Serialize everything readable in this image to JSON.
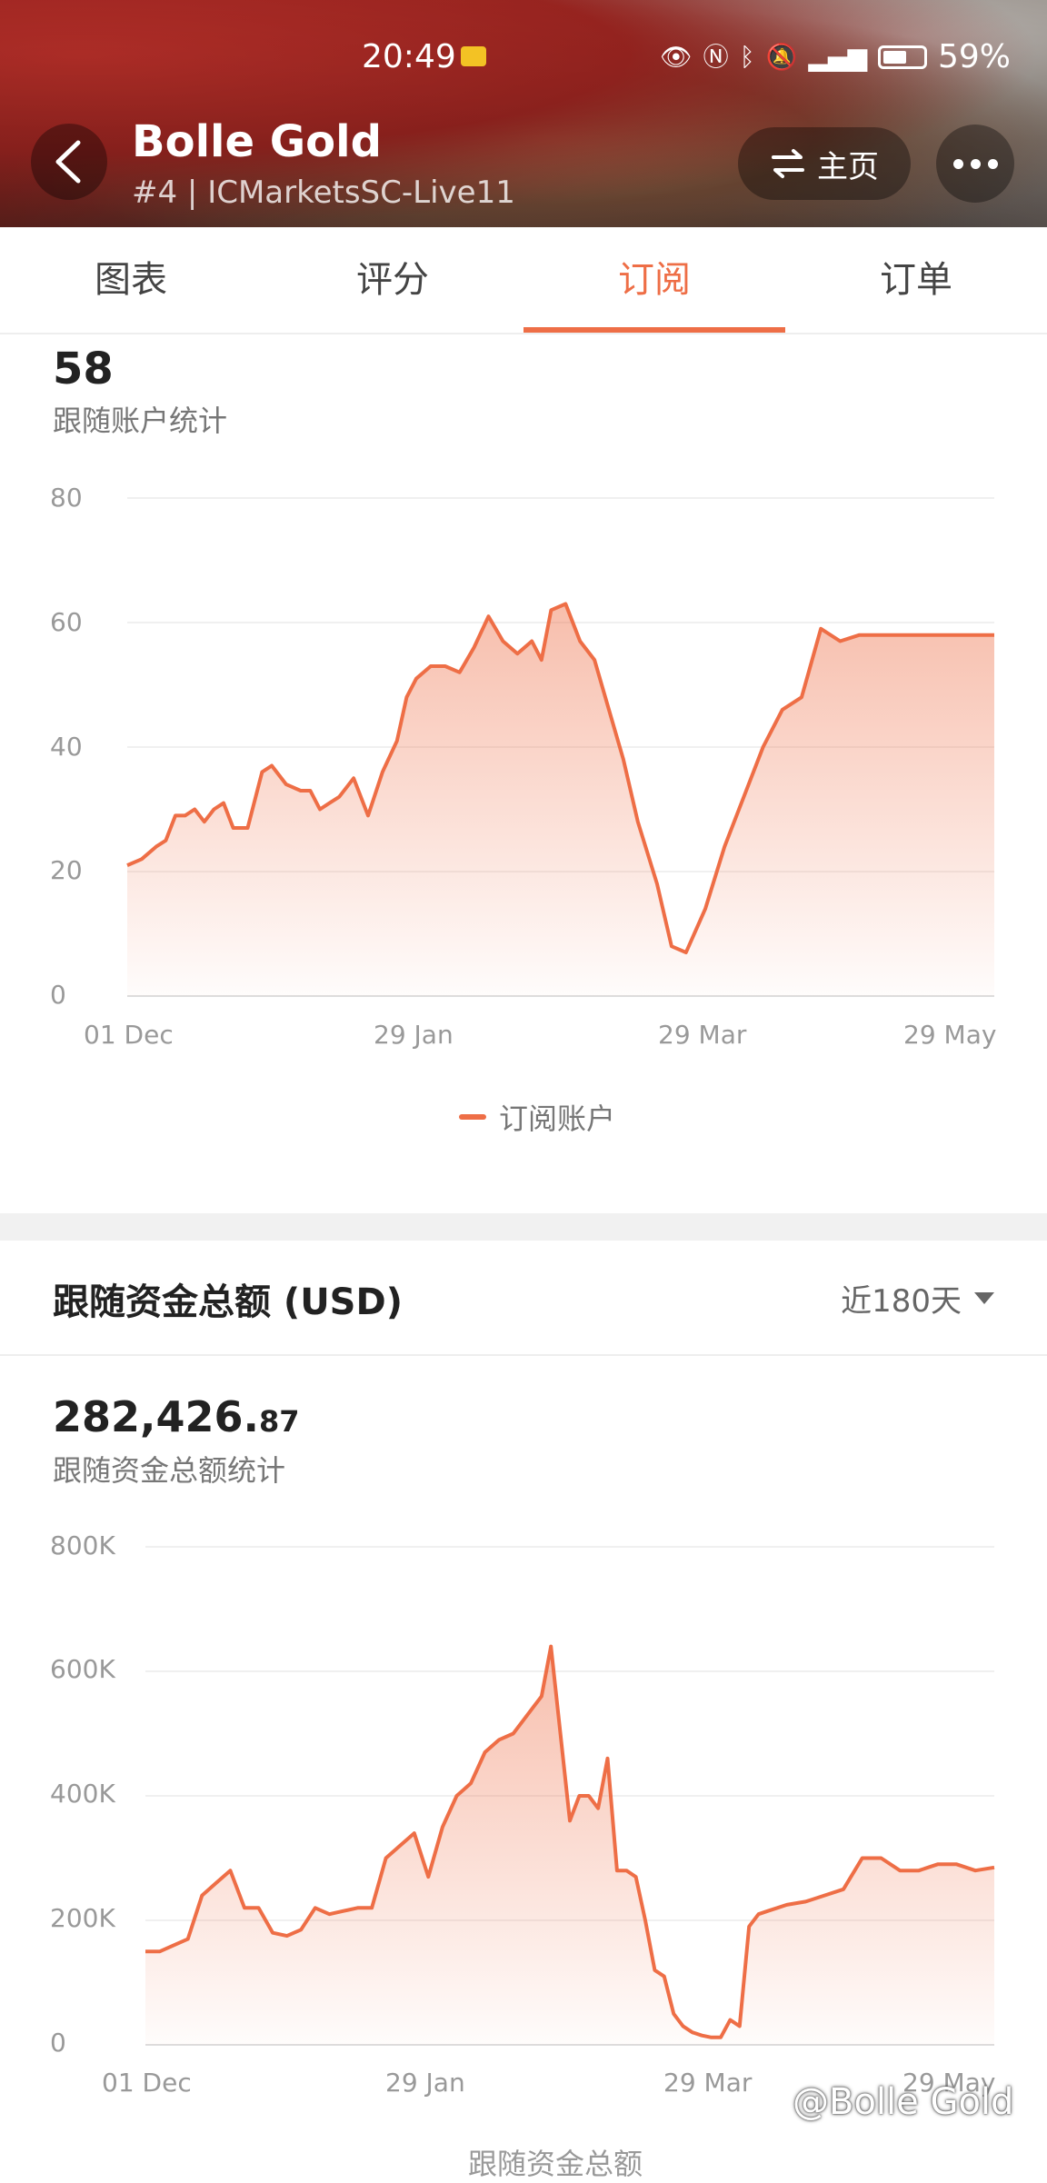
{
  "status_bar": {
    "time": "20:49",
    "battery": "59%",
    "battery_level": 0.59
  },
  "header": {
    "title": "Bolle Gold",
    "subtitle": "#4 | ICMarketsSC-Live11",
    "home_label": "主页"
  },
  "tabs": [
    {
      "label": "图表"
    },
    {
      "label": "评分"
    },
    {
      "label": "订阅",
      "active": true
    },
    {
      "label": "订单"
    }
  ],
  "followers": {
    "value": "58",
    "caption": "跟随账户统计",
    "legend": "订阅账户"
  },
  "funds": {
    "title": "跟随资金总额 (USD)",
    "range": "近180天",
    "value_main": "282,426.",
    "value_decimal": "87",
    "caption": "跟随资金总额统计",
    "legend": "跟随资金总额"
  },
  "watermark": "@Bolle Gold",
  "colors": {
    "accent": "#ee6e46"
  },
  "chart_data": [
    {
      "type": "area",
      "series": [
        {
          "name": "订阅账户",
          "x": [
            0,
            3,
            6,
            8,
            10,
            12,
            14,
            16,
            18,
            20,
            22,
            25,
            28,
            30,
            33,
            36,
            38,
            40,
            42,
            44,
            47,
            50,
            53,
            56,
            58,
            60,
            63,
            66,
            69,
            72,
            75,
            78,
            81,
            84,
            86,
            88,
            91,
            94,
            97,
            100,
            103,
            106,
            110,
            113,
            116,
            120,
            124,
            128,
            132,
            136,
            140,
            144,
            148,
            152,
            156,
            160,
            164,
            168,
            172,
            176,
            180
          ],
          "values": [
            21,
            22,
            24,
            25,
            29,
            29,
            30,
            28,
            30,
            31,
            27,
            27,
            36,
            37,
            34,
            33,
            33,
            30,
            31,
            32,
            35,
            29,
            36,
            41,
            48,
            51,
            53,
            53,
            52,
            56,
            61,
            57,
            55,
            57,
            54,
            62,
            63,
            57,
            54,
            46,
            38,
            28,
            18,
            8,
            7,
            14,
            24,
            32,
            40,
            46,
            48,
            59,
            57,
            58,
            58,
            58,
            58,
            58,
            58,
            58,
            58
          ]
        }
      ],
      "xticks": [
        "01 Dec",
        "29 Jan",
        "29 Mar",
        "29 May"
      ],
      "yticks": [
        "0",
        "20",
        "40",
        "60",
        "80"
      ],
      "ylim": [
        0,
        80
      ]
    },
    {
      "type": "area",
      "series": [
        {
          "name": "跟随资金总额",
          "x": [
            0,
            3,
            6,
            9,
            12,
            15,
            18,
            21,
            24,
            27,
            30,
            33,
            36,
            39,
            42,
            45,
            48,
            51,
            54,
            57,
            60,
            63,
            66,
            69,
            72,
            75,
            78,
            80,
            82,
            84,
            86,
            88,
            90,
            92,
            94,
            96,
            98,
            100,
            102,
            104,
            106,
            108,
            110,
            112,
            114,
            116,
            118,
            120,
            122,
            124,
            126,
            128,
            130,
            132,
            134,
            136,
            140,
            144,
            148,
            152,
            156,
            160,
            164,
            168,
            172,
            176,
            180
          ],
          "values": [
            150,
            150,
            160,
            170,
            240,
            260,
            280,
            220,
            220,
            180,
            175,
            185,
            220,
            210,
            215,
            220,
            220,
            300,
            320,
            340,
            270,
            350,
            400,
            420,
            470,
            490,
            500,
            520,
            540,
            560,
            640,
            500,
            360,
            400,
            400,
            380,
            460,
            280,
            280,
            270,
            200,
            120,
            110,
            50,
            30,
            20,
            15,
            12,
            12,
            40,
            30,
            190,
            210,
            215,
            220,
            225,
            230,
            240,
            250,
            300,
            300,
            280,
            280,
            290,
            290,
            280,
            285
          ]
        }
      ],
      "xticks": [
        "01 Dec",
        "29 Jan",
        "29 Mar",
        "29 May"
      ],
      "yticks": [
        "0",
        "200K",
        "400K",
        "600K",
        "800K"
      ],
      "ylim": [
        0,
        800
      ],
      "unit": "K USD"
    }
  ]
}
